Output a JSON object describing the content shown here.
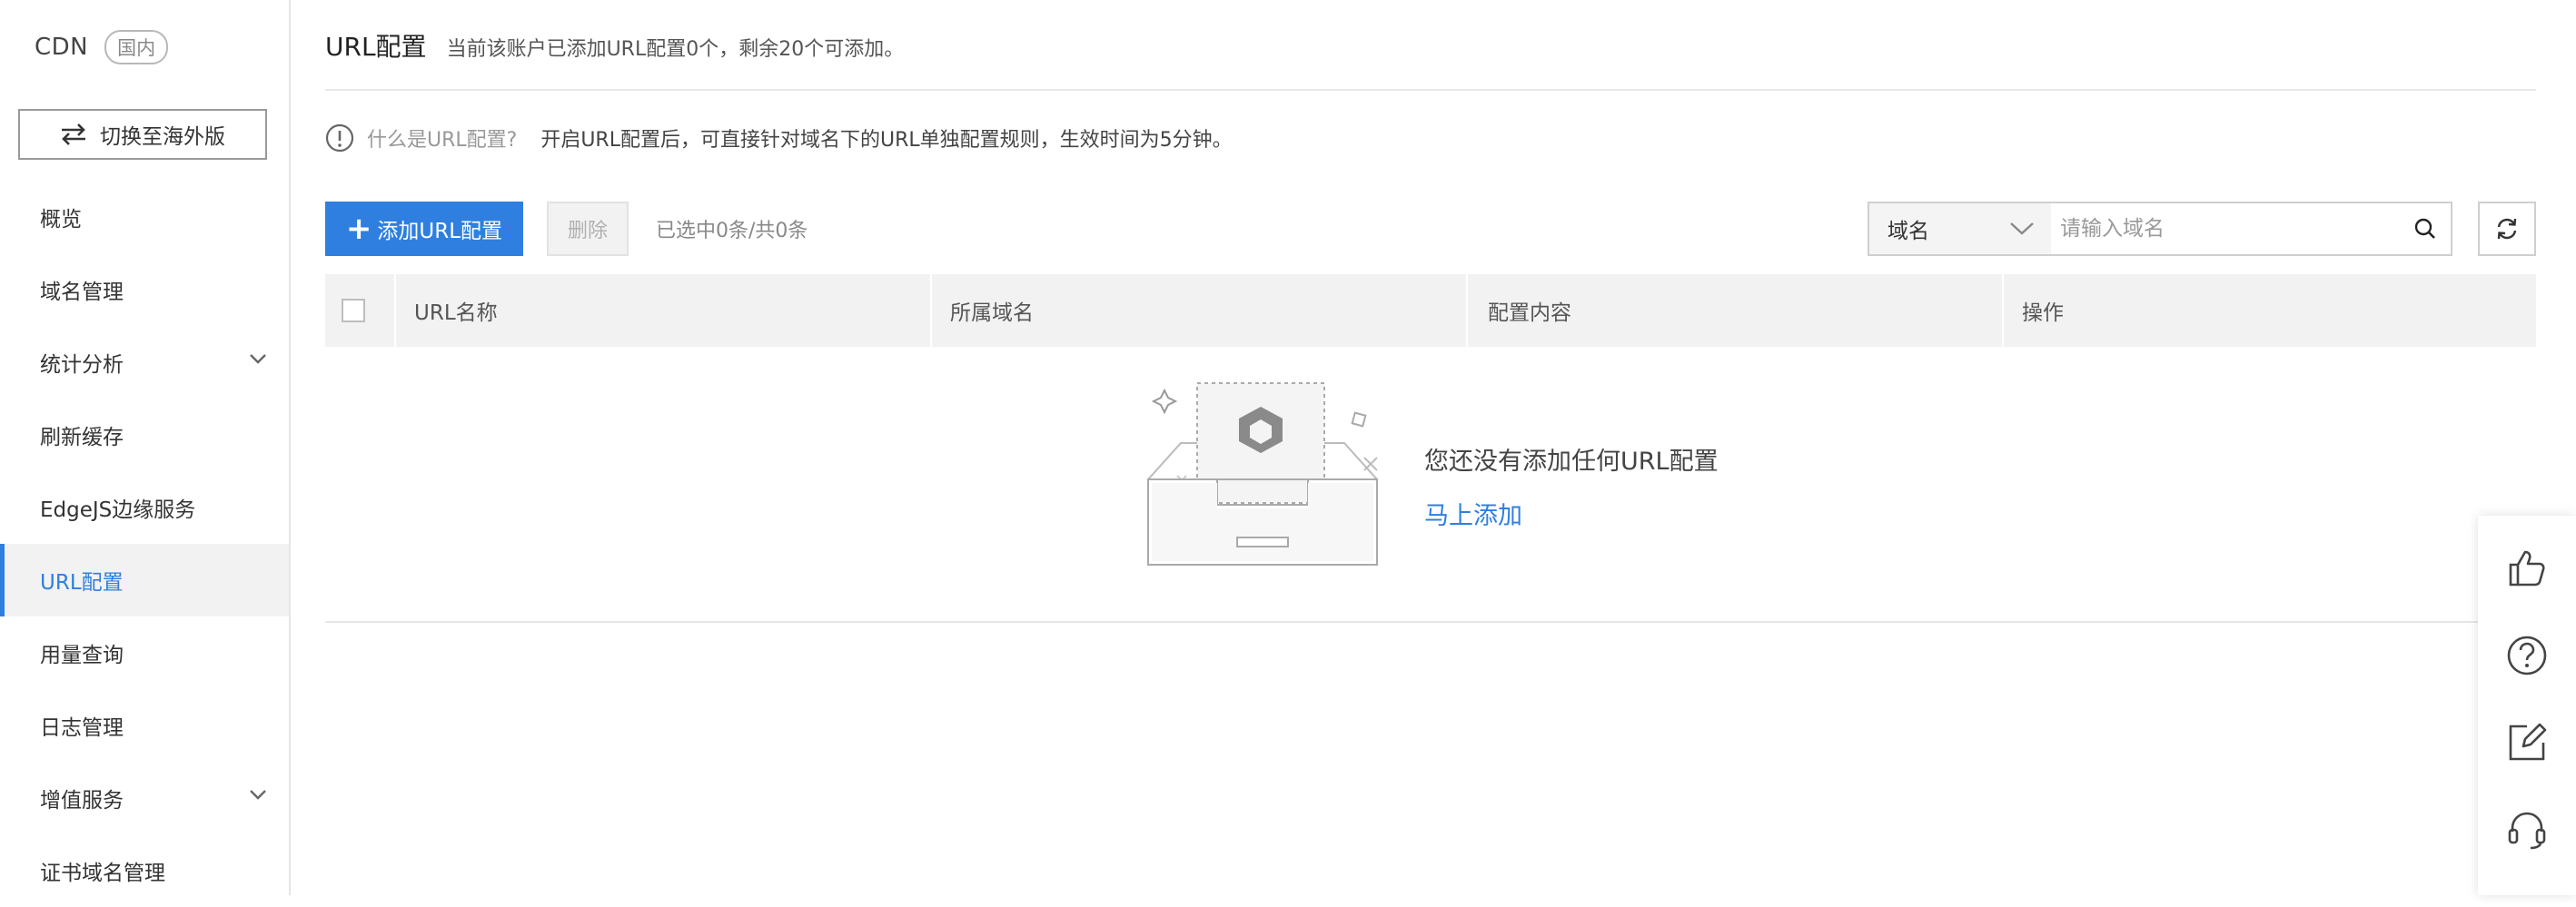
{
  "sidebar": {
    "brand": "CDN",
    "region_badge": "国内",
    "switch_label": "切换至海外版",
    "items": [
      {
        "label": "概览"
      },
      {
        "label": "域名管理"
      },
      {
        "label": "统计分析"
      },
      {
        "label": "刷新缓存"
      },
      {
        "label": "EdgeJS边缘服务"
      },
      {
        "label": "URL配置",
        "active": true
      },
      {
        "label": "用量查询"
      },
      {
        "label": "日志管理"
      },
      {
        "label": "增值服务"
      },
      {
        "label": "证书域名管理"
      }
    ]
  },
  "header": {
    "title": "URL配置",
    "subtitle": "当前该账户已添加URL配置0个，剩余20个可添加。"
  },
  "info": {
    "question": "什么是URL配置?",
    "text": "开启URL配置后，可直接针对域名下的URL单独配置规则，生效时间为5分钟。"
  },
  "toolbar": {
    "add_label": "添加URL配置",
    "delete_label": "删除",
    "selection_text": "已选中0条/共0条",
    "search_field": "域名",
    "search_placeholder": "请输入域名"
  },
  "table": {
    "columns": [
      "URL名称",
      "所属域名",
      "配置内容",
      "操作"
    ],
    "rows": []
  },
  "empty": {
    "message": "您还没有添加任何URL配置",
    "action": "马上添加"
  },
  "float_toolbar": {
    "icons": [
      "thumbs-up-icon",
      "help-circle-icon",
      "edit-note-icon",
      "headset-icon"
    ]
  },
  "colors": {
    "accent": "#2e7fe0",
    "header_bg": "#f2f2f2",
    "border": "#e6e6e6"
  }
}
